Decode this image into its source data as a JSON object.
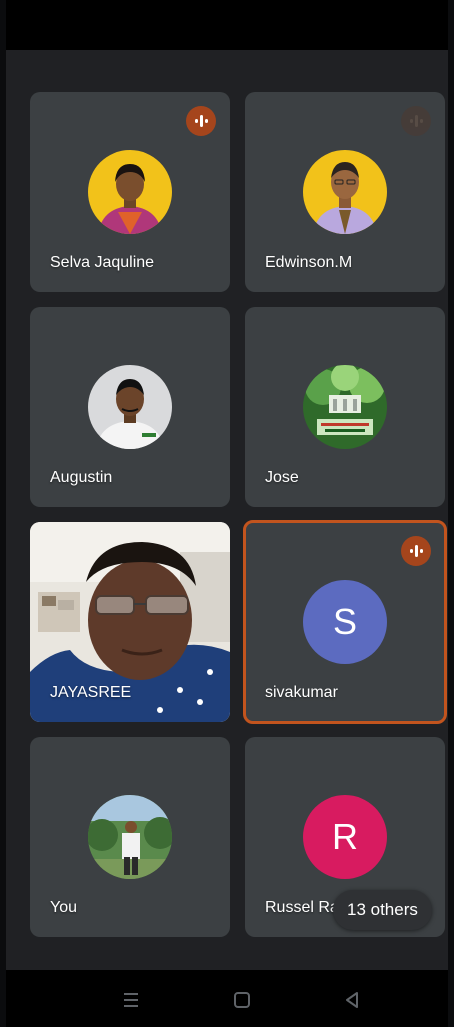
{
  "participants": [
    {
      "name": "Selva Jaquline",
      "avatar_type": "photo",
      "speaking": true
    },
    {
      "name": "Edwinson.M",
      "avatar_type": "photo",
      "speaking": false
    },
    {
      "name": "Augustin",
      "avatar_type": "photo",
      "speaking": false
    },
    {
      "name": "Jose",
      "avatar_type": "photo",
      "speaking": false
    },
    {
      "name": "JAYASREE",
      "avatar_type": "video",
      "speaking": false
    },
    {
      "name": "sivakumar",
      "avatar_type": "letter",
      "initial": "S",
      "avatar_color": "#5c6bc0",
      "speaking": true,
      "highlighted": true
    },
    {
      "name": "You",
      "avatar_type": "photo",
      "speaking": false
    },
    {
      "name": "Russel Ra",
      "avatar_type": "letter",
      "initial": "R",
      "avatar_color": "#d81b60",
      "speaking": false
    }
  ],
  "others": {
    "label": "13 others"
  },
  "nav": [
    "menu-icon",
    "home-icon",
    "back-icon"
  ],
  "colors": {
    "background": "#202124",
    "tile": "#3c4043",
    "highlight": "#c2541e",
    "speaking_badge": "#a5451c"
  }
}
